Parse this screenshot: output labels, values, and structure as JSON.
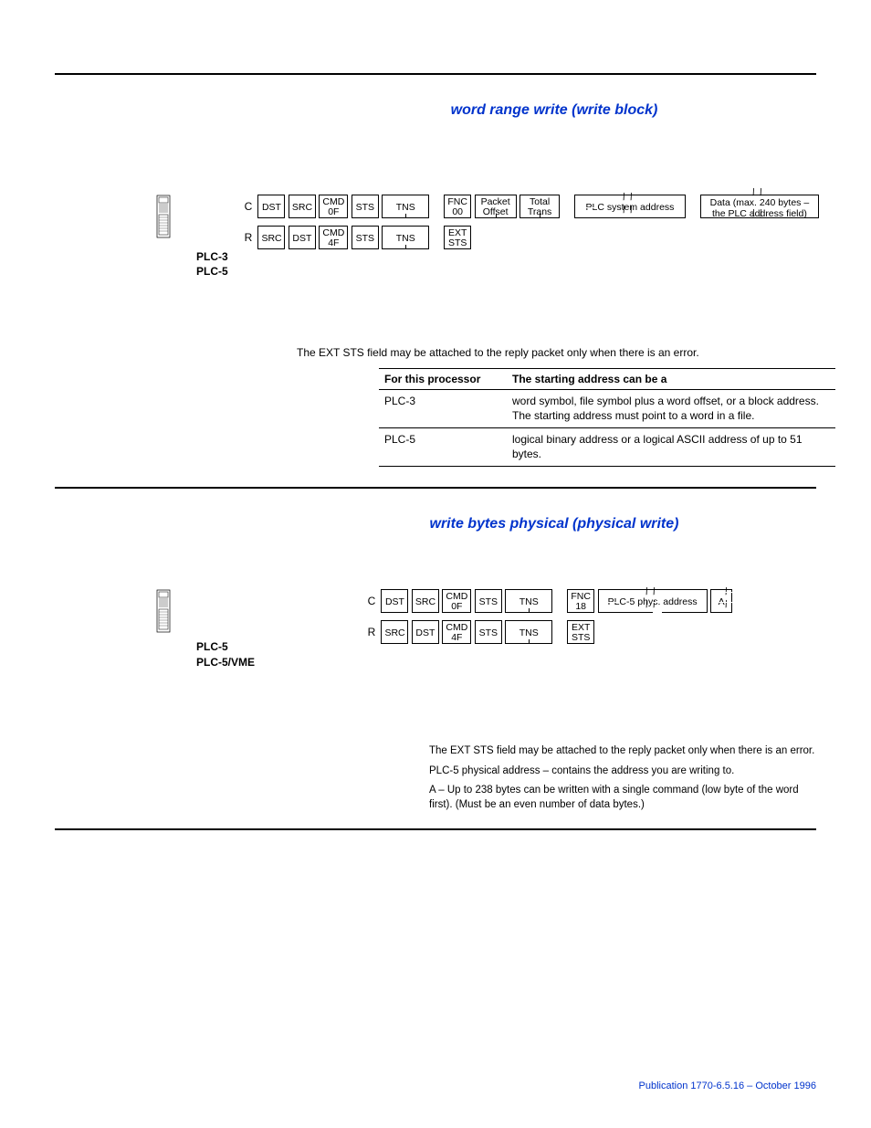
{
  "section1": {
    "title": "word range write (write block)",
    "labels": [
      "PLC-3",
      "PLC-5"
    ],
    "rowC": {
      "label": "C",
      "cells": [
        "DST",
        "SRC",
        "CMD\n0F",
        "STS",
        "TNS",
        "FNC\n00",
        "Packet\nOffset",
        "Total\nTrans",
        "PLC system address",
        "Data (max. 240 bytes –\nthe PLC address field)"
      ]
    },
    "rowR": {
      "label": "R",
      "cells": [
        "SRC",
        "DST",
        "CMD\n4F",
        "STS",
        "TNS",
        "EXT\nSTS"
      ]
    },
    "note": "The EXT STS field may be attached to the reply packet only when there is an error.",
    "table": {
      "headers": [
        "For this processor",
        "The starting address can be a"
      ],
      "rows": [
        [
          "PLC-3",
          "word symbol, file symbol plus a word offset, or a block address. The starting address must point to a word in a file."
        ],
        [
          "PLC-5",
          "logical binary address or a logical ASCII address of up to 51 bytes."
        ]
      ]
    }
  },
  "section2": {
    "title": "write bytes physical (physical write)",
    "labels": [
      "PLC-5",
      "PLC-5/VME"
    ],
    "rowC": {
      "label": "C",
      "cells": [
        "DST",
        "SRC",
        "CMD\n0F",
        "STS",
        "TNS",
        "FNC\n18",
        "PLC-5 phys. address",
        "A"
      ]
    },
    "rowR": {
      "label": "R",
      "cells": [
        "SRC",
        "DST",
        "CMD\n4F",
        "STS",
        "TNS",
        "EXT\nSTS"
      ]
    },
    "notes": [
      "The EXT STS field may be attached to the reply packet only when there is an error.",
      "PLC-5 physical address – contains the address you are writing to.",
      "A – Up to 238 bytes can be written with a single command (low byte of the word first). (Must be an even number of data bytes.)"
    ]
  },
  "publication": "Publication 1770-6.5.16 – October 1996"
}
